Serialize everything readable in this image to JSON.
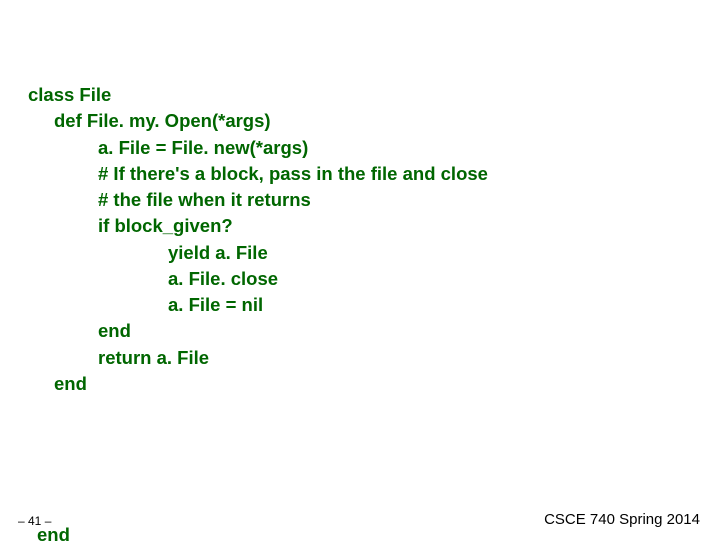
{
  "code": {
    "l1": "class File",
    "l2": "def File. my. Open(*args)",
    "l3": "a. File = File. new(*args)",
    "l4": "# If there's a block, pass in the file and close",
    "l5": "# the file when it returns",
    "l6": "if block_given?",
    "l7": "yield a. File",
    "l8": "a. File. close",
    "l9": "a. File = nil",
    "l10": "end",
    "l11": "return a. File",
    "l12": "end",
    "l13": "end"
  },
  "footer": {
    "page": "– 41 –",
    "course": "CSCE 740 Spring 2014"
  }
}
